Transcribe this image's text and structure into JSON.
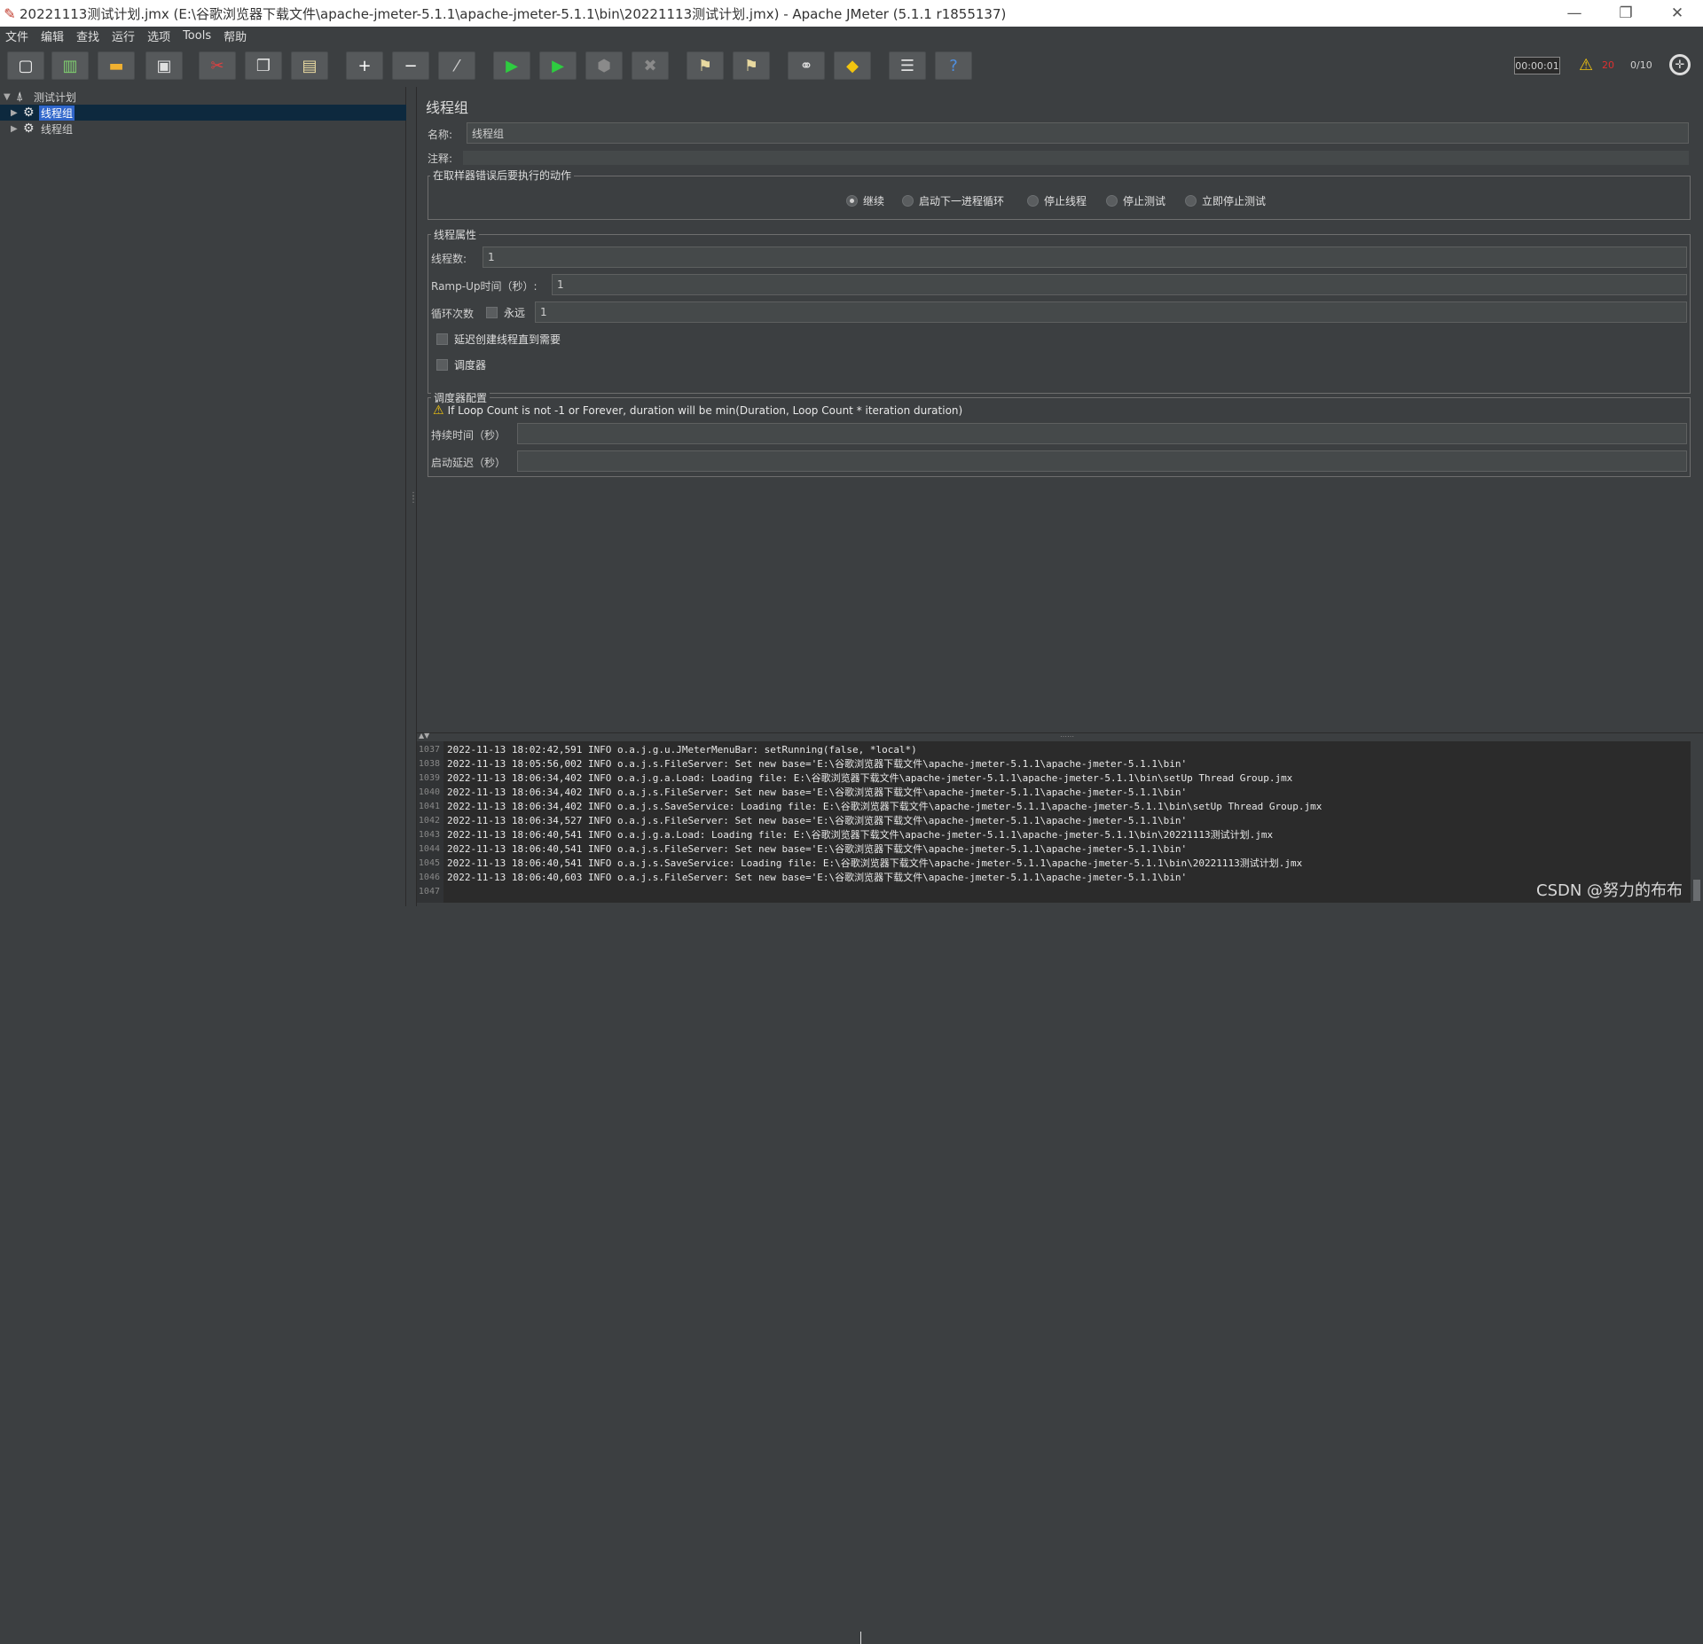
{
  "window": {
    "title": "20221113测试计划.jmx (E:\\谷歌浏览器下载文件\\apache-jmeter-5.1.1\\apache-jmeter-5.1.1\\bin\\20221113测试计划.jmx) - Apache JMeter (5.1.1 r1855137)",
    "minimize": "—",
    "restore": "❐",
    "close": "✕"
  },
  "menu": [
    "文件",
    "编辑",
    "查找",
    "运行",
    "选项",
    "Tools",
    "帮助"
  ],
  "toolbar": {
    "timer": "00:00:01",
    "error_count": "20",
    "threads": "0/10",
    "buttons": [
      {
        "name": "new-icon",
        "glyph": "▢",
        "color": "#f5f5f5"
      },
      {
        "name": "templates-icon",
        "glyph": "▥",
        "color": "#7fcf6f"
      },
      {
        "name": "open-icon",
        "glyph": "▬",
        "color": "#f0b030"
      },
      {
        "name": "save-icon",
        "glyph": "▣",
        "color": "#e0e0e0"
      },
      {
        "name": "cut-icon",
        "glyph": "✂",
        "color": "#e04040"
      },
      {
        "name": "copy-icon",
        "glyph": "❐",
        "color": "#e0e0e0"
      },
      {
        "name": "paste-icon",
        "glyph": "▤",
        "color": "#e8d9a0"
      },
      {
        "name": "expand-icon",
        "glyph": "+",
        "color": "#ffffff"
      },
      {
        "name": "collapse-icon",
        "glyph": "−",
        "color": "#ffffff"
      },
      {
        "name": "toggle-icon",
        "glyph": "⁄",
        "color": "#d0d0d0"
      },
      {
        "name": "start-icon",
        "glyph": "▶",
        "color": "#2ecc40"
      },
      {
        "name": "start-no-pause-icon",
        "glyph": "▶",
        "color": "#2ecc40"
      },
      {
        "name": "stop-icon",
        "glyph": "⬢",
        "color": "#8a8a8a"
      },
      {
        "name": "shutdown-icon",
        "glyph": "✖",
        "color": "#8a8a8a"
      },
      {
        "name": "clear-icon",
        "glyph": "⚑",
        "color": "#e8d9a0"
      },
      {
        "name": "clear-all-icon",
        "glyph": "⚑",
        "color": "#e8d9a0"
      },
      {
        "name": "search-icon",
        "glyph": "⚭",
        "color": "#e0e0e0"
      },
      {
        "name": "reset-search-icon",
        "glyph": "◆",
        "color": "#f1c40f"
      },
      {
        "name": "function-helper-icon",
        "glyph": "☰",
        "color": "#e0e0e0"
      },
      {
        "name": "help-icon",
        "glyph": "?",
        "color": "#4f8fe0"
      }
    ]
  },
  "tree": {
    "root": "测试计划",
    "items": [
      "线程组",
      "线程组"
    ]
  },
  "panel": {
    "title": "线程组",
    "name_label": "名称:",
    "name_value": "线程组",
    "comment_label": "注释:",
    "error_action": {
      "title": "在取样器错误后要执行的动作",
      "options": [
        "继续",
        "启动下一进程循环",
        "停止线程",
        "停止测试",
        "立即停止测试"
      ],
      "selected": "继续"
    },
    "thread_props": {
      "title": "线程属性",
      "threads_label": "线程数:",
      "threads_value": "1",
      "rampup_label": "Ramp-Up时间（秒）:",
      "rampup_value": "1",
      "loop_label": "循环次数",
      "forever_label": "永远",
      "loop_value": "1",
      "delay_label": "延迟创建线程直到需要",
      "scheduler_label": "调度器"
    },
    "scheduler": {
      "title": "调度器配置",
      "warning": "If Loop Count is not -1 or Forever, duration will be min(Duration, Loop Count * iteration duration)",
      "duration_label": "持续时间（秒）",
      "delay_label": "启动延迟（秒）"
    }
  },
  "log": {
    "lines": [
      {
        "n": "1037",
        "t": "2022-11-13 18:02:42,591 INFO o.a.j.g.u.JMeterMenuBar: setRunning(false, *local*)"
      },
      {
        "n": "1038",
        "t": "2022-11-13 18:05:56,002 INFO o.a.j.s.FileServer: Set new base='E:\\谷歌浏览器下载文件\\apache-jmeter-5.1.1\\apache-jmeter-5.1.1\\bin'"
      },
      {
        "n": "1039",
        "t": "2022-11-13 18:06:34,402 INFO o.a.j.g.a.Load: Loading file: E:\\谷歌浏览器下载文件\\apache-jmeter-5.1.1\\apache-jmeter-5.1.1\\bin\\setUp Thread Group.jmx"
      },
      {
        "n": "1040",
        "t": "2022-11-13 18:06:34,402 INFO o.a.j.s.FileServer: Set new base='E:\\谷歌浏览器下载文件\\apache-jmeter-5.1.1\\apache-jmeter-5.1.1\\bin'"
      },
      {
        "n": "1041",
        "t": "2022-11-13 18:06:34,402 INFO o.a.j.s.SaveService: Loading file: E:\\谷歌浏览器下载文件\\apache-jmeter-5.1.1\\apache-jmeter-5.1.1\\bin\\setUp Thread Group.jmx"
      },
      {
        "n": "1042",
        "t": "2022-11-13 18:06:34,527 INFO o.a.j.s.FileServer: Set new base='E:\\谷歌浏览器下载文件\\apache-jmeter-5.1.1\\apache-jmeter-5.1.1\\bin'"
      },
      {
        "n": "1043",
        "t": "2022-11-13 18:06:40,541 INFO o.a.j.g.a.Load: Loading file: E:\\谷歌浏览器下载文件\\apache-jmeter-5.1.1\\apache-jmeter-5.1.1\\bin\\20221113测试计划.jmx"
      },
      {
        "n": "1044",
        "t": "2022-11-13 18:06:40,541 INFO o.a.j.s.FileServer: Set new base='E:\\谷歌浏览器下载文件\\apache-jmeter-5.1.1\\apache-jmeter-5.1.1\\bin'"
      },
      {
        "n": "1045",
        "t": "2022-11-13 18:06:40,541 INFO o.a.j.s.SaveService: Loading file: E:\\谷歌浏览器下载文件\\apache-jmeter-5.1.1\\apache-jmeter-5.1.1\\bin\\20221113测试计划.jmx"
      },
      {
        "n": "1046",
        "t": "2022-11-13 18:06:40,603 INFO o.a.j.s.FileServer: Set new base='E:\\谷歌浏览器下载文件\\apache-jmeter-5.1.1\\apache-jmeter-5.1.1\\bin'"
      },
      {
        "n": "1047",
        "t": ""
      }
    ]
  },
  "watermark": "CSDN @努力的布布"
}
